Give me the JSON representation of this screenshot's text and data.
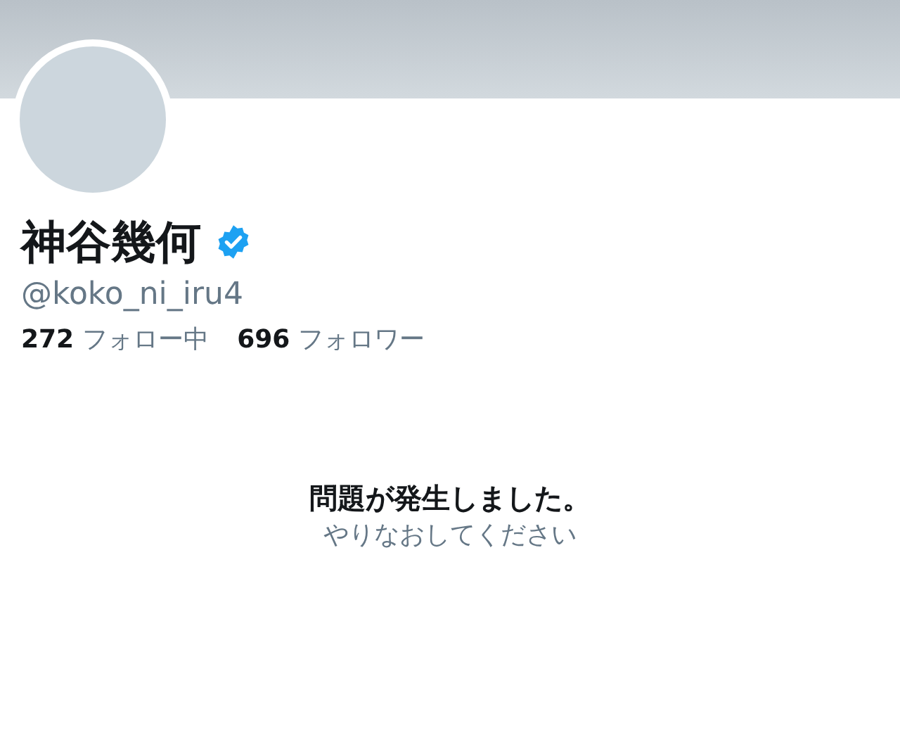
{
  "profile": {
    "name": "神谷幾何",
    "verified": true,
    "handle": "@koko_ni_iru4",
    "stats": [
      {
        "count": "272",
        "label": "フォロー中"
      },
      {
        "count": "696",
        "label": "フォロワー"
      }
    ]
  },
  "error": {
    "title": "問題が発生しました。",
    "message": "やりなおしてください"
  }
}
